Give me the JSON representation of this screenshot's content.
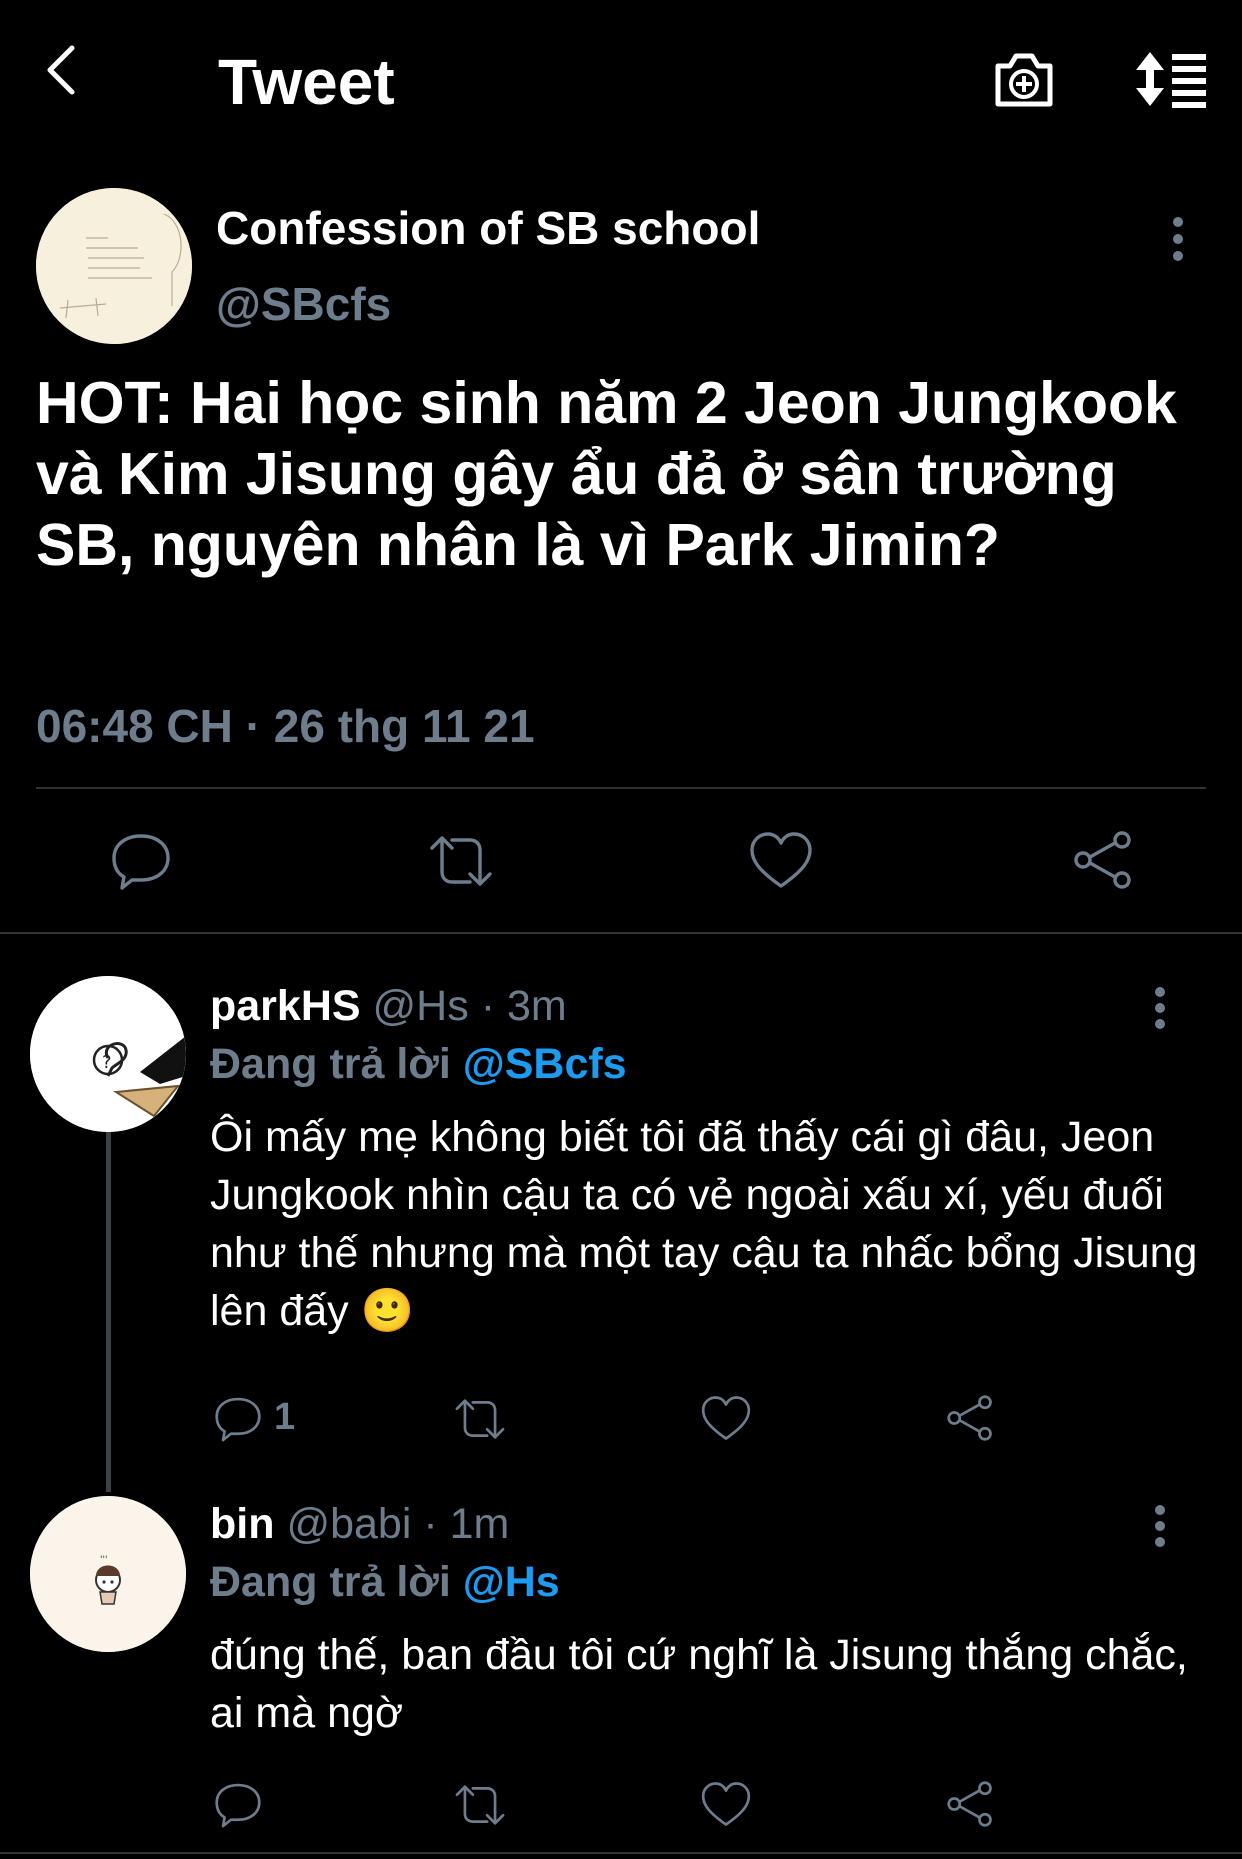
{
  "header": {
    "title": "Tweet",
    "back_icon": "chevron-left-icon",
    "camera_icon": "camera-plus-icon",
    "sort_icon": "sort-icon"
  },
  "tweet": {
    "display_name": "Confession of SB school",
    "handle": "@SBcfs",
    "text": "HOT: Hai học sinh năm 2 Jeon Jungkook và Kim Jisung gây ẩu đả ở sân trường SB, nguyên nhân là vì Park Jimin?",
    "timestamp": "06:48 CH · 26 thg 11 21"
  },
  "replies": [
    {
      "display_name": "parkHS",
      "handle": "@Hs",
      "time": "· 3m",
      "replying_prefix": "Đang trả lời",
      "replying_to": "@SBcfs",
      "text": "Ôi mấy mẹ không biết tôi đã thấy cái gì đâu, Jeon Jungkook nhìn cậu ta có vẻ ngoài xấu xí, yếu đuối như thế nhưng mà một tay cậu ta nhấc bổng Jisung lên đấy 🙂",
      "reply_count": "1"
    },
    {
      "display_name": "bin",
      "handle": "@babi",
      "time": "· 1m",
      "replying_prefix": "Đang trả lời",
      "replying_to": "@Hs",
      "text": "đúng thế, ban đầu tôi cứ nghĩ là Jisung thắng chắc, ai mà ngờ",
      "reply_count": ""
    }
  ],
  "colors": {
    "background": "#000000",
    "secondary_text": "#6e7d8c",
    "link": "#1d9bf0",
    "divider": "#2f3336"
  }
}
